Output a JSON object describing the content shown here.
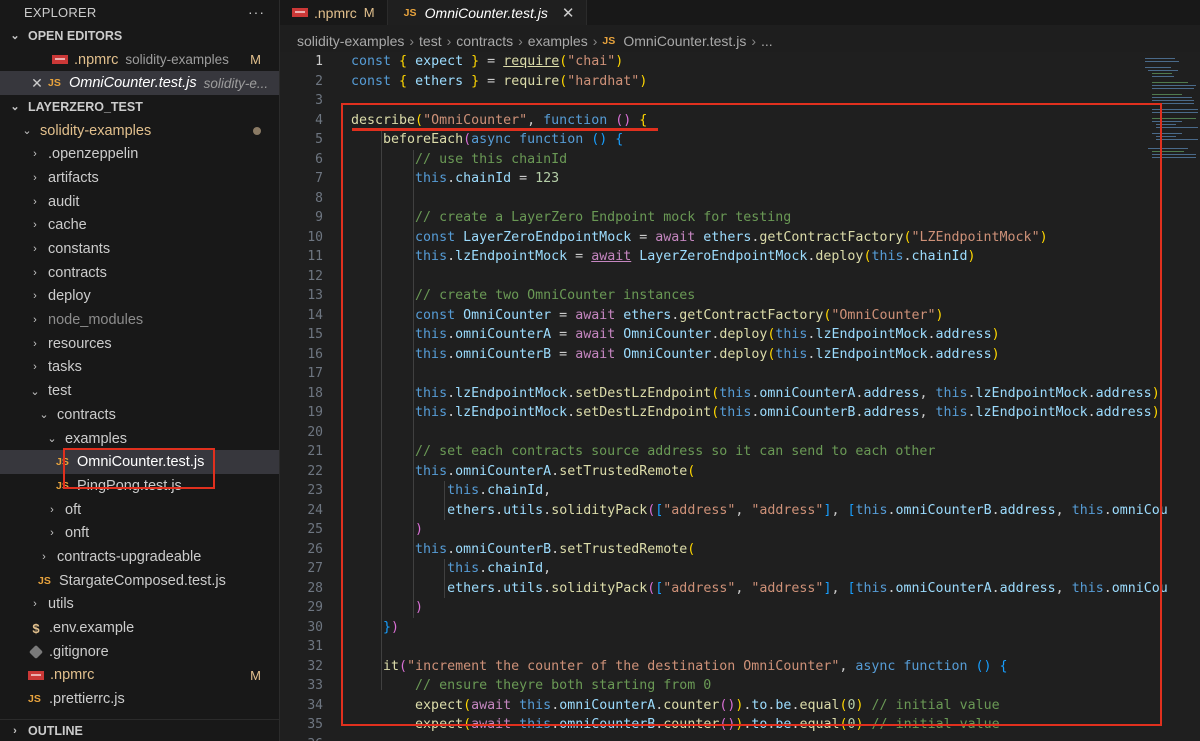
{
  "sidebar": {
    "title": "EXPLORER",
    "more": "···",
    "open_editors": {
      "label": "OPEN EDITORS",
      "items": [
        {
          "name": ".npmrc",
          "desc": "solidity-examples",
          "badge": "M"
        },
        {
          "name": "OmniCounter.test.js",
          "desc": "solidity-e..."
        }
      ]
    },
    "workspace": {
      "label": "LAYERZERO_TEST",
      "root": "solidity-examples",
      "items": [
        ".openzeppelin",
        "artifacts",
        "audit",
        "cache",
        "constants",
        "contracts",
        "deploy",
        "node_modules",
        "resources",
        "tasks",
        "test"
      ],
      "test_children": {
        "contracts": "contracts",
        "examples": "examples",
        "files": [
          "OmniCounter.test.js",
          "PingPong.test.js"
        ],
        "sub": [
          "oft",
          "onft"
        ],
        "upgradeable": "contracts-upgradeable",
        "composed": "StargateComposed.test.js"
      },
      "tail": {
        "utils": "utils",
        "env": ".env.example",
        "gitignore": ".gitignore",
        "npmrc": ".npmrc",
        "npmrc_badge": "M",
        "prettier": ".prettierrc.js"
      }
    },
    "outline": "OUTLINE",
    "icons": {
      "js": "JS",
      "env": "$"
    }
  },
  "tabs": [
    {
      "label": ".npmrc",
      "badge": "M"
    },
    {
      "label": "OmniCounter.test.js",
      "close": "✕"
    }
  ],
  "breadcrumb": [
    "solidity-examples",
    "test",
    "contracts",
    "examples",
    "OmniCounter.test.js",
    "..."
  ],
  "colors": {
    "accent_red": "#e0301e",
    "modified": "#e2c08d",
    "js_icon": "#e8a33d"
  }
}
